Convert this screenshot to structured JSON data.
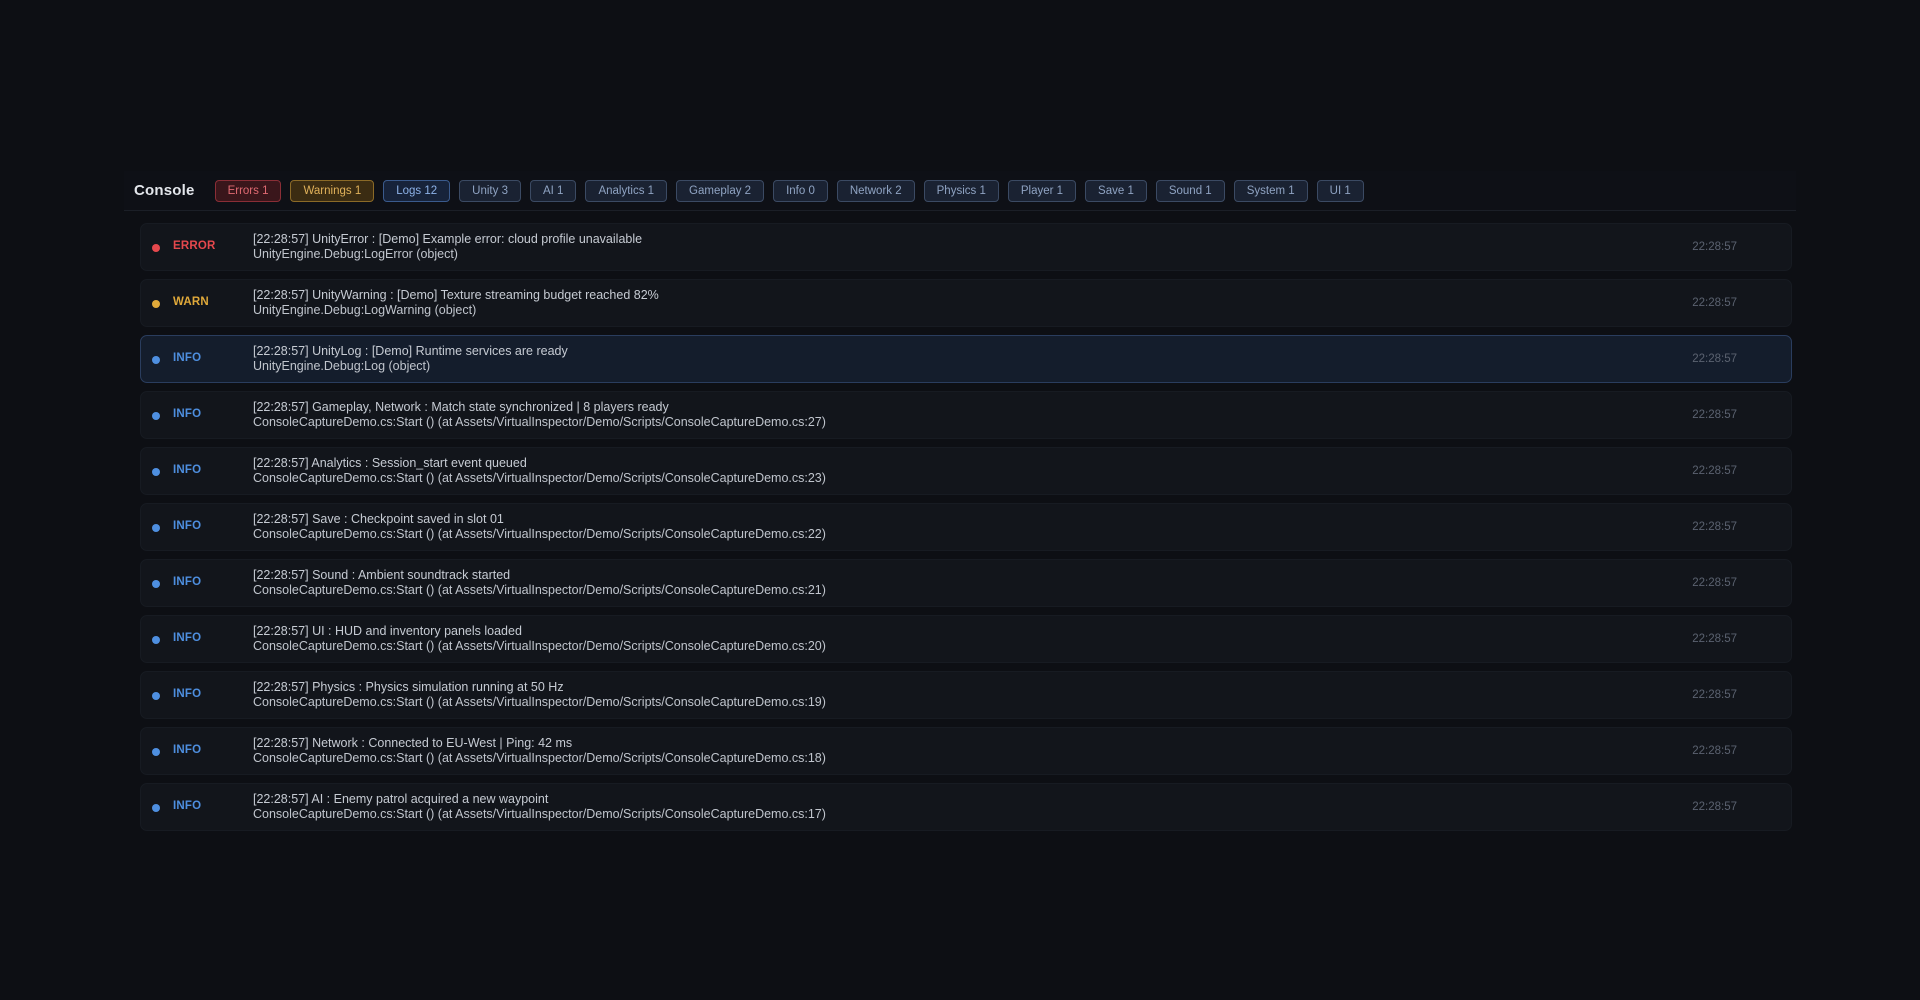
{
  "console": {
    "title": "Console",
    "filters": [
      {
        "label": "Errors 1",
        "kind": "error"
      },
      {
        "label": "Warnings 1",
        "kind": "warning"
      },
      {
        "label": "Logs 12",
        "kind": "logs"
      },
      {
        "label": "Unity 3",
        "kind": "category"
      },
      {
        "label": "AI 1",
        "kind": "category"
      },
      {
        "label": "Analytics 1",
        "kind": "category"
      },
      {
        "label": "Gameplay 2",
        "kind": "category"
      },
      {
        "label": "Info 0",
        "kind": "category"
      },
      {
        "label": "Network 2",
        "kind": "category"
      },
      {
        "label": "Physics 1",
        "kind": "category"
      },
      {
        "label": "Player 1",
        "kind": "category"
      },
      {
        "label": "Save 1",
        "kind": "category"
      },
      {
        "label": "Sound 1",
        "kind": "category"
      },
      {
        "label": "System 1",
        "kind": "category"
      },
      {
        "label": "UI 1",
        "kind": "category"
      }
    ],
    "entries": [
      {
        "level": "ERROR",
        "color": "#e5484d",
        "message": "[22:28:57] UnityError : [Demo] Example error: cloud profile unavailable",
        "trace": "UnityEngine.Debug:LogError (object)",
        "time": "22:28:57",
        "selected": false
      },
      {
        "level": "WARN",
        "color": "#e0a93a",
        "message": "[22:28:57] UnityWarning : [Demo] Texture streaming budget reached 82%",
        "trace": "UnityEngine.Debug:LogWarning (object)",
        "time": "22:28:57",
        "selected": false
      },
      {
        "level": "INFO",
        "color": "#4e8fe0",
        "message": "[22:28:57] UnityLog : [Demo] Runtime services are ready",
        "trace": "UnityEngine.Debug:Log (object)",
        "time": "22:28:57",
        "selected": true
      },
      {
        "level": "INFO",
        "color": "#4e8fe0",
        "message": "[22:28:57] Gameplay, Network : Match state synchronized | 8 players ready",
        "trace": "ConsoleCaptureDemo.cs:Start () (at Assets/VirtualInspector/Demo/Scripts/ConsoleCaptureDemo.cs:27)",
        "time": "22:28:57",
        "selected": false
      },
      {
        "level": "INFO",
        "color": "#4e8fe0",
        "message": "[22:28:57] Analytics : Session_start event queued",
        "trace": "ConsoleCaptureDemo.cs:Start () (at Assets/VirtualInspector/Demo/Scripts/ConsoleCaptureDemo.cs:23)",
        "time": "22:28:57",
        "selected": false
      },
      {
        "level": "INFO",
        "color": "#4e8fe0",
        "message": "[22:28:57] Save : Checkpoint saved in slot 01",
        "trace": "ConsoleCaptureDemo.cs:Start () (at Assets/VirtualInspector/Demo/Scripts/ConsoleCaptureDemo.cs:22)",
        "time": "22:28:57",
        "selected": false
      },
      {
        "level": "INFO",
        "color": "#4e8fe0",
        "message": "[22:28:57] Sound : Ambient soundtrack started",
        "trace": "ConsoleCaptureDemo.cs:Start () (at Assets/VirtualInspector/Demo/Scripts/ConsoleCaptureDemo.cs:21)",
        "time": "22:28:57",
        "selected": false
      },
      {
        "level": "INFO",
        "color": "#4e8fe0",
        "message": "[22:28:57] UI : HUD and inventory panels loaded",
        "trace": "ConsoleCaptureDemo.cs:Start () (at Assets/VirtualInspector/Demo/Scripts/ConsoleCaptureDemo.cs:20)",
        "time": "22:28:57",
        "selected": false
      },
      {
        "level": "INFO",
        "color": "#4e8fe0",
        "message": "[22:28:57] Physics : Physics simulation running at 50 Hz",
        "trace": "ConsoleCaptureDemo.cs:Start () (at Assets/VirtualInspector/Demo/Scripts/ConsoleCaptureDemo.cs:19)",
        "time": "22:28:57",
        "selected": false
      },
      {
        "level": "INFO",
        "color": "#4e8fe0",
        "message": "[22:28:57] Network : Connected to EU-West | Ping: 42 ms",
        "trace": "ConsoleCaptureDemo.cs:Start () (at Assets/VirtualInspector/Demo/Scripts/ConsoleCaptureDemo.cs:18)",
        "time": "22:28:57",
        "selected": false
      },
      {
        "level": "INFO",
        "color": "#4e8fe0",
        "message": "[22:28:57] AI : Enemy patrol acquired a new waypoint",
        "trace": "ConsoleCaptureDemo.cs:Start () (at Assets/VirtualInspector/Demo/Scripts/ConsoleCaptureDemo.cs:17)",
        "time": "22:28:57",
        "selected": false
      }
    ]
  }
}
